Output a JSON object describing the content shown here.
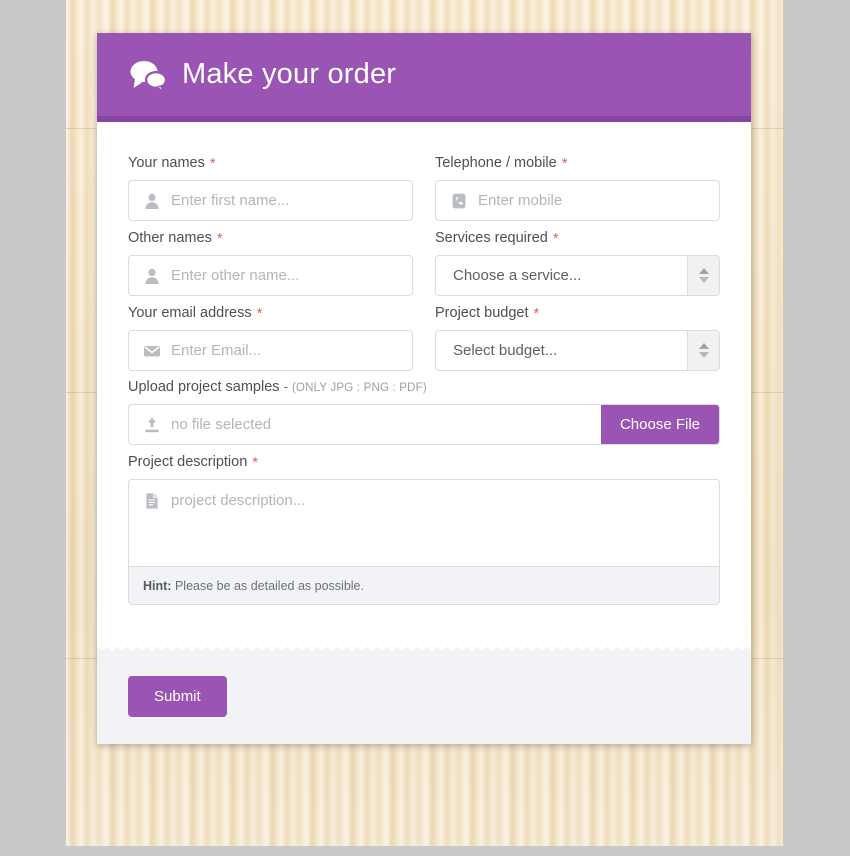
{
  "header": {
    "title": "Make your order",
    "icon": "comments-icon",
    "bg_color": "#9a55b4",
    "accent_border_color": "#8944a3"
  },
  "theme": {
    "purple": "#9a55b4",
    "required_star_color": "#e8615a",
    "footer_bg": "#f2f3f7",
    "desk_bg": "#c9c9c9"
  },
  "form": {
    "required_marker": "*",
    "fields": {
      "your_names": {
        "label": "Your names",
        "required": true,
        "icon": "user-icon",
        "placeholder": "Enter first name...",
        "value": ""
      },
      "telephone": {
        "label": "Telephone / mobile",
        "required": true,
        "icon": "phone-icon",
        "placeholder": "Enter mobile",
        "value": ""
      },
      "other_names": {
        "label": "Other names",
        "required": true,
        "icon": "user-icon",
        "placeholder": "Enter other name...",
        "value": ""
      },
      "services_required": {
        "label": "Services required",
        "required": true,
        "selected": "Choose a service...",
        "control": "select"
      },
      "email": {
        "label": "Your email address",
        "required": true,
        "icon": "envelope-icon",
        "placeholder": "Enter Email...",
        "value": ""
      },
      "project_budget": {
        "label": "Project budget",
        "required": true,
        "selected": "Select budget...",
        "control": "select"
      },
      "upload": {
        "label": "Upload project samples",
        "label_dash": "-",
        "label_note": "(ONLY JPG : PNG : PDF)",
        "icon": "upload-icon",
        "file_status": "no file selected",
        "button_label": "Choose File"
      },
      "project_description": {
        "label": "Project description",
        "required": true,
        "icon": "document-icon",
        "placeholder": "project description...",
        "value": "",
        "hint_prefix": "Hint:",
        "hint_text": "Please be as detailed as possible."
      }
    },
    "submit_label": "Submit"
  }
}
